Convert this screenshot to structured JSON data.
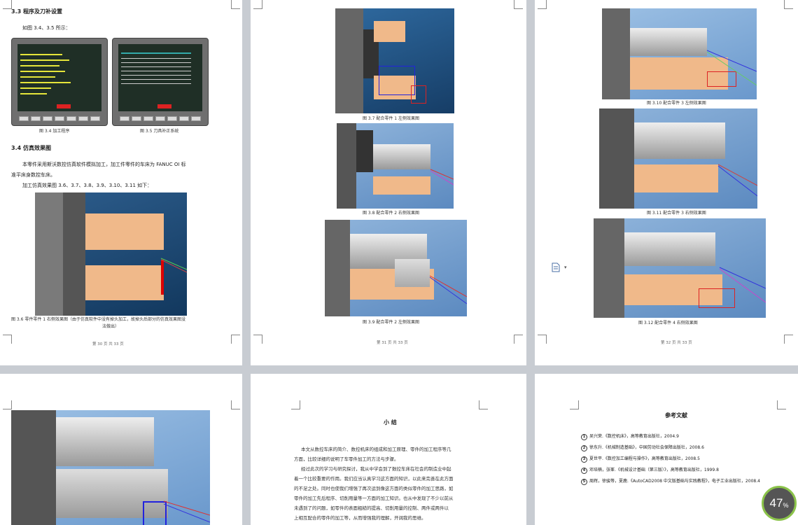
{
  "pages": {
    "p1": {
      "heading_33": "3.3 程序及刀补设置",
      "intro_33": "如图 3.4、3.5 所示：",
      "cap_34": "图 3.4 加工程序",
      "cap_35": "图 3.5 刀具补正系统",
      "heading_34": "3.4 仿真效果图",
      "body_1": "本零件采用斯沃数控仿真软件模拟加工，加工件零件的车床为 FANUC OI 标",
      "body_2": "准平床身数控车床。",
      "body_3": "加工仿真效果图 3.6、3.7、3.8、3.9、3.10、3.11 如下：",
      "cap_36": "图 3.6 零件零件 1 右侧效果图（由于仿真软件中没有掉头加工，故掉头后部分的仿真效果图没",
      "cap_36b": "法做出）",
      "footer": "第 30 页 共 33 页"
    },
    "p2": {
      "cap_37": "图 3.7 配合零件 1 左侧效果图",
      "cap_38": "图 3.8 配合零件 2 右侧效果图",
      "cap_39": "图 3.9 配合零件 2 左侧效果图",
      "footer": "第 31 页 共 33 页"
    },
    "p3": {
      "cap_310": "图 3.10 配合零件 3 左侧效果图",
      "cap_311": "图 3.11 配合零件 3 右侧效果图",
      "cap_312": "图 3.12 配合零件 4 右侧效果图",
      "footer": "第 32 页 共 33 页"
    },
    "p5": {
      "title": "小 结",
      "lines": [
        "本文从数控车床的简介、数控机床的组成和加工原理、零件的加工程序等几",
        "方面，比较详细的说明了车零件加工的方法与步骤。",
        "经过此次的学习与研究探讨，我从中学会到了数控车床在社会的制造业中起",
        "着一个比较重要的作用。我们应当认真学习这方面的知识，以此来完善在此方面",
        "的不足之处。同时也使我们增强了再次运到像这方面的类似零件的加工思路，如",
        "零件的加工先后程序、切削用量等一方面的加工知识。也从中发现了不少以前从",
        "未遇到了的问题，如零件的表面粗糙的提高、切削用量的控制、两件或两件以",
        "上相互配合的零件的加工等，从而增强我的理解，开阔我的思维。"
      ]
    },
    "p6": {
      "title": "参考文献",
      "refs": [
        {
          "n": "1",
          "text": "吴兴荣.《数控机床》，高等教育出版社，2004.9"
        },
        {
          "n": "2",
          "text": "徐东升.《机械制造基础》，中国劳动社会保障出版社，2008.6"
        },
        {
          "n": "3",
          "text": "夏世平.《数控加工编程与操作》，高等教育出版社，2008.5"
        },
        {
          "n": "4",
          "text": "邓培楠，张峯.《机械设计基础（第三版）》，高等教育出版社，1999.8"
        },
        {
          "n": "5",
          "text": "周辉，徐骏等，夏鹿.《AutoCAD2008 中文版基础与实践教程》，电子工业出版社，2008.4"
        }
      ]
    }
  },
  "zoom": "47",
  "zoom_unit": "%",
  "doc_icon": "document-icon"
}
